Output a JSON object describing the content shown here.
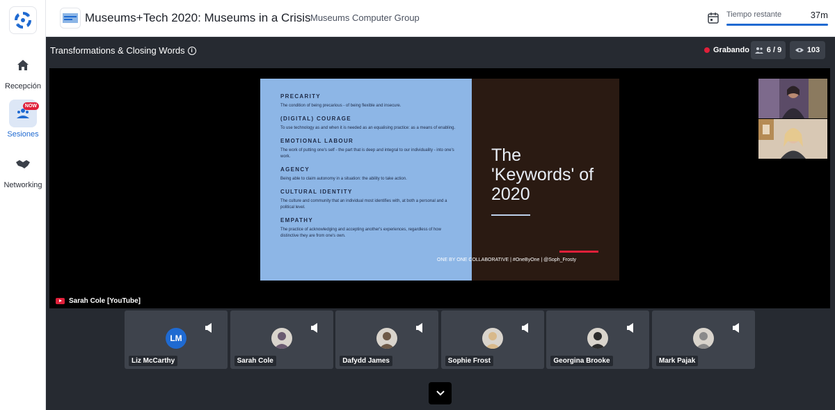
{
  "sidebar": {
    "items": [
      {
        "label": "Recepción",
        "icon": "home-icon"
      },
      {
        "label": "Sesiones",
        "icon": "sessions-icon",
        "badge": "NOW",
        "active": true
      },
      {
        "label": "Networking",
        "icon": "handshake-icon"
      }
    ]
  },
  "header": {
    "title": "Museums+Tech 2020: Museums in a Crisis",
    "organizer": "Museums Computer Group",
    "timer_label": "Tiempo restante",
    "timer_value": "37m",
    "timer_progress": 1.0
  },
  "session": {
    "title": "Transformations & Closing Words",
    "recording_label": "Grabando",
    "speakers_count": "6 / 9",
    "viewers_count": "103",
    "stream_label": "Sarah Cole [YouTube]"
  },
  "slide": {
    "keywords": [
      {
        "term": "PRECARITY",
        "definition": "The condition of being precarious - of being flexible and insecure."
      },
      {
        "term": "(DIGITAL) COURAGE",
        "definition": "To use technology as and when it is needed as an equalising practice: as a means of enabling."
      },
      {
        "term": "EMOTIONAL LABOUR",
        "definition": "The work of putting one's self - the part that is deep and integral to our individuality - into one's work."
      },
      {
        "term": "AGENCY",
        "definition": "Being able to claim autonomy in a situation: the ability to take action."
      },
      {
        "term": "CULTURAL IDENTITY",
        "definition": "The culture and community that an individual most identifies with, at both a personal and a political level."
      },
      {
        "term": "EMPATHY",
        "definition": "The practice of acknowledging and accepting another's experiences, regardless of how distinctive they are from one's own."
      }
    ],
    "headline_line1": "The",
    "headline_line2": "'Keywords' of",
    "headline_line3": "2020",
    "footer": "ONE BY ONE COLLABORATIVE | #OneByOne | @Soph_Frosty"
  },
  "participants": [
    {
      "name": "Liz McCarthy",
      "initials": "LM"
    },
    {
      "name": "Sarah Cole",
      "initials": ""
    },
    {
      "name": "Dafydd James",
      "initials": ""
    },
    {
      "name": "Sophie Frost",
      "initials": ""
    },
    {
      "name": "Georgina Brooke",
      "initials": ""
    },
    {
      "name": "Mark Pajak",
      "initials": ""
    }
  ],
  "colors": {
    "accent": "#1f6ad1",
    "recording": "#e0203a",
    "stage_bg": "#262a31",
    "tile_bg": "#3e434c"
  }
}
